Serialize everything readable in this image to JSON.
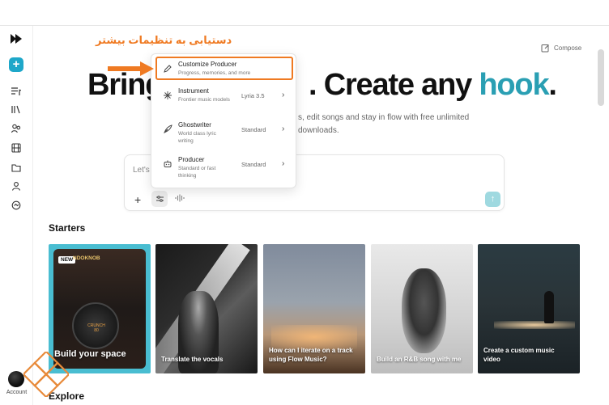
{
  "sidebar": {
    "account_label": "Account",
    "icons": [
      "playlist-icon",
      "library-icon",
      "people-icon",
      "film-icon",
      "folder-icon",
      "person-icon",
      "history-icon"
    ]
  },
  "header": {
    "compose_label": "Compose"
  },
  "hero": {
    "left_text": "Bring",
    "right_text": ". Create any ",
    "accent_word": "hook",
    "trailing": ".",
    "subtext_line1": "s, edit songs and stay in flow with free unlimited",
    "subtext_line2": "downloads."
  },
  "prompt": {
    "placeholder": "Let's"
  },
  "dropdown": {
    "items": [
      {
        "title": "Customize Producer",
        "subtitle": "Progress, memories, and more",
        "value": ""
      },
      {
        "title": "Instrument",
        "subtitle": "Frontier music models",
        "value": "Lyria 3.5"
      },
      {
        "title": "Ghostwriter",
        "subtitle": "World class lyric writing",
        "value": "Standard"
      },
      {
        "title": "Producer",
        "subtitle": "Standard or fast thinking",
        "value": "Standard"
      }
    ]
  },
  "annotation": {
    "text": "دستیابی به تنظیمات بیشتر"
  },
  "starters": {
    "title": "Starters",
    "cards": [
      {
        "label": "Build your space",
        "badge": "NEW",
        "knob_title": "NDOKNOB",
        "dial_text": "CRUNCH 80"
      },
      {
        "label": "Translate the vocals"
      },
      {
        "label": "How can I iterate on a track using Flow Music?"
      },
      {
        "label": "Build an R&B song with me"
      },
      {
        "label": "Create a custom music video"
      }
    ]
  },
  "explore": {
    "title": "Explore"
  },
  "colors": {
    "accent": "#2a9fb3",
    "highlight": "#ef7a22",
    "primary_button": "#1ea7c9"
  }
}
